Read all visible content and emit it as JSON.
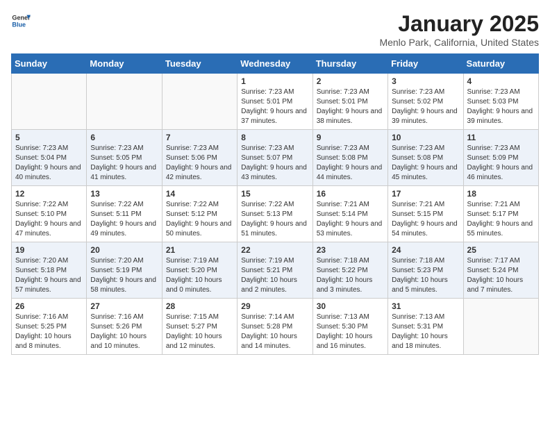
{
  "header": {
    "logo_line1": "General",
    "logo_line2": "Blue",
    "month": "January 2025",
    "location": "Menlo Park, California, United States"
  },
  "days_of_week": [
    "Sunday",
    "Monday",
    "Tuesday",
    "Wednesday",
    "Thursday",
    "Friday",
    "Saturday"
  ],
  "weeks": [
    [
      {
        "day": "",
        "info": ""
      },
      {
        "day": "",
        "info": ""
      },
      {
        "day": "",
        "info": ""
      },
      {
        "day": "1",
        "info": "Sunrise: 7:23 AM\nSunset: 5:01 PM\nDaylight: 9 hours and 37 minutes."
      },
      {
        "day": "2",
        "info": "Sunrise: 7:23 AM\nSunset: 5:01 PM\nDaylight: 9 hours and 38 minutes."
      },
      {
        "day": "3",
        "info": "Sunrise: 7:23 AM\nSunset: 5:02 PM\nDaylight: 9 hours and 39 minutes."
      },
      {
        "day": "4",
        "info": "Sunrise: 7:23 AM\nSunset: 5:03 PM\nDaylight: 9 hours and 39 minutes."
      }
    ],
    [
      {
        "day": "5",
        "info": "Sunrise: 7:23 AM\nSunset: 5:04 PM\nDaylight: 9 hours and 40 minutes."
      },
      {
        "day": "6",
        "info": "Sunrise: 7:23 AM\nSunset: 5:05 PM\nDaylight: 9 hours and 41 minutes."
      },
      {
        "day": "7",
        "info": "Sunrise: 7:23 AM\nSunset: 5:06 PM\nDaylight: 9 hours and 42 minutes."
      },
      {
        "day": "8",
        "info": "Sunrise: 7:23 AM\nSunset: 5:07 PM\nDaylight: 9 hours and 43 minutes."
      },
      {
        "day": "9",
        "info": "Sunrise: 7:23 AM\nSunset: 5:08 PM\nDaylight: 9 hours and 44 minutes."
      },
      {
        "day": "10",
        "info": "Sunrise: 7:23 AM\nSunset: 5:08 PM\nDaylight: 9 hours and 45 minutes."
      },
      {
        "day": "11",
        "info": "Sunrise: 7:23 AM\nSunset: 5:09 PM\nDaylight: 9 hours and 46 minutes."
      }
    ],
    [
      {
        "day": "12",
        "info": "Sunrise: 7:22 AM\nSunset: 5:10 PM\nDaylight: 9 hours and 47 minutes."
      },
      {
        "day": "13",
        "info": "Sunrise: 7:22 AM\nSunset: 5:11 PM\nDaylight: 9 hours and 49 minutes."
      },
      {
        "day": "14",
        "info": "Sunrise: 7:22 AM\nSunset: 5:12 PM\nDaylight: 9 hours and 50 minutes."
      },
      {
        "day": "15",
        "info": "Sunrise: 7:22 AM\nSunset: 5:13 PM\nDaylight: 9 hours and 51 minutes."
      },
      {
        "day": "16",
        "info": "Sunrise: 7:21 AM\nSunset: 5:14 PM\nDaylight: 9 hours and 53 minutes."
      },
      {
        "day": "17",
        "info": "Sunrise: 7:21 AM\nSunset: 5:15 PM\nDaylight: 9 hours and 54 minutes."
      },
      {
        "day": "18",
        "info": "Sunrise: 7:21 AM\nSunset: 5:17 PM\nDaylight: 9 hours and 55 minutes."
      }
    ],
    [
      {
        "day": "19",
        "info": "Sunrise: 7:20 AM\nSunset: 5:18 PM\nDaylight: 9 hours and 57 minutes."
      },
      {
        "day": "20",
        "info": "Sunrise: 7:20 AM\nSunset: 5:19 PM\nDaylight: 9 hours and 58 minutes."
      },
      {
        "day": "21",
        "info": "Sunrise: 7:19 AM\nSunset: 5:20 PM\nDaylight: 10 hours and 0 minutes."
      },
      {
        "day": "22",
        "info": "Sunrise: 7:19 AM\nSunset: 5:21 PM\nDaylight: 10 hours and 2 minutes."
      },
      {
        "day": "23",
        "info": "Sunrise: 7:18 AM\nSunset: 5:22 PM\nDaylight: 10 hours and 3 minutes."
      },
      {
        "day": "24",
        "info": "Sunrise: 7:18 AM\nSunset: 5:23 PM\nDaylight: 10 hours and 5 minutes."
      },
      {
        "day": "25",
        "info": "Sunrise: 7:17 AM\nSunset: 5:24 PM\nDaylight: 10 hours and 7 minutes."
      }
    ],
    [
      {
        "day": "26",
        "info": "Sunrise: 7:16 AM\nSunset: 5:25 PM\nDaylight: 10 hours and 8 minutes."
      },
      {
        "day": "27",
        "info": "Sunrise: 7:16 AM\nSunset: 5:26 PM\nDaylight: 10 hours and 10 minutes."
      },
      {
        "day": "28",
        "info": "Sunrise: 7:15 AM\nSunset: 5:27 PM\nDaylight: 10 hours and 12 minutes."
      },
      {
        "day": "29",
        "info": "Sunrise: 7:14 AM\nSunset: 5:28 PM\nDaylight: 10 hours and 14 minutes."
      },
      {
        "day": "30",
        "info": "Sunrise: 7:13 AM\nSunset: 5:30 PM\nDaylight: 10 hours and 16 minutes."
      },
      {
        "day": "31",
        "info": "Sunrise: 7:13 AM\nSunset: 5:31 PM\nDaylight: 10 hours and 18 minutes."
      },
      {
        "day": "",
        "info": ""
      }
    ]
  ]
}
